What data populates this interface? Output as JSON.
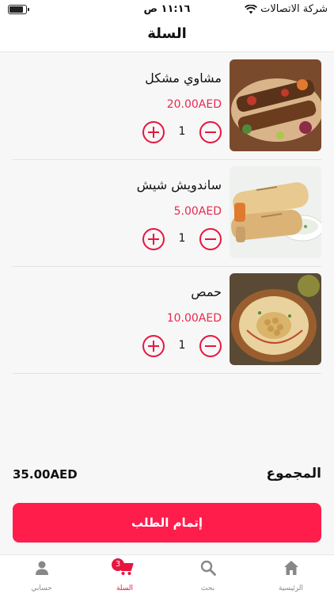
{
  "status_bar": {
    "carrier": "شركة الاتصالات",
    "time": "١١:١٦ ص",
    "battery_level": 0.85
  },
  "header": {
    "title": "السلة"
  },
  "cart": {
    "items": [
      {
        "name": "مشاوي مشكل",
        "price": "20.00AED",
        "quantity": "1",
        "image": "mixed-grill-photo"
      },
      {
        "name": "ساندويش شيش",
        "price": "5.00AED",
        "quantity": "1",
        "image": "shish-sandwich-photo"
      },
      {
        "name": "حمص",
        "price": "10.00AED",
        "quantity": "1",
        "image": "hummus-photo"
      }
    ]
  },
  "summary": {
    "total_label": "المجموع",
    "total_amount": "35.00AED"
  },
  "checkout": {
    "label": "إتمام الطلب"
  },
  "tab_bar": {
    "tabs": [
      {
        "label": "الرئيسية",
        "icon": "home-icon"
      },
      {
        "label": "بحث",
        "icon": "search-icon"
      },
      {
        "label": "السلة",
        "icon": "cart-icon",
        "badge": "3"
      },
      {
        "label": "حسابي",
        "icon": "person-icon"
      }
    ]
  },
  "colors": {
    "accent": "#e8153f",
    "button": "#ff1d4c",
    "price": "#e62a4f"
  }
}
